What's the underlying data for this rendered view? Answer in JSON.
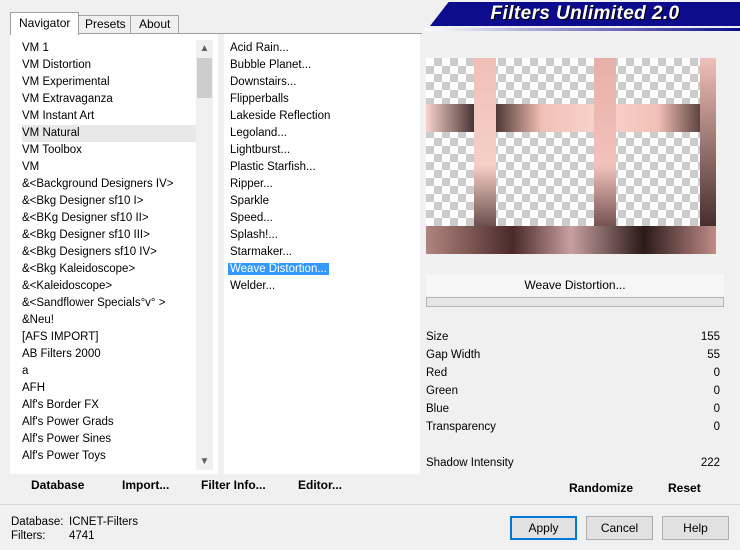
{
  "tabs": [
    "Navigator",
    "Presets",
    "About"
  ],
  "banner_title": "Filters Unlimited 2.0",
  "categories": [
    "VM 1",
    "VM Distortion",
    "VM Experimental",
    "VM Extravaganza",
    "VM Instant Art",
    "VM Natural",
    "VM Toolbox",
    "VM",
    "&<Background Designers IV>",
    "&<Bkg Designer sf10 I>",
    "&<BKg Designer sf10 II>",
    "&<Bkg Designer sf10 III>",
    "&<Bkg Designers sf10 IV>",
    "&<Bkg Kaleidoscope>",
    "&<Kaleidoscope>",
    "&<Sandflower Specials°v° >",
    "&Neu!",
    "[AFS IMPORT]",
    "AB Filters 2000",
    "a",
    "AFH",
    "Alf's Border FX",
    "Alf's Power Grads",
    "Alf's Power Sines",
    "Alf's Power Toys"
  ],
  "selected_category": "VM Natural",
  "filters": [
    "Acid Rain...",
    "Bubble Planet...",
    "Downstairs...",
    "Flipperballs",
    "Lakeside Reflection",
    "Legoland...",
    "Lightburst...",
    "Plastic Starfish...",
    "Ripper...",
    "Sparkle",
    "Speed...",
    "Splash!...",
    "Starmaker...",
    "Weave Distortion...",
    "Welder..."
  ],
  "selected_filter": "Weave Distortion...",
  "left_buttons": [
    "Database",
    "Import...",
    "Filter Info...",
    "Editor..."
  ],
  "preview_filter_name": "Weave Distortion...",
  "params": [
    {
      "label": "Size",
      "value": "155"
    },
    {
      "label": "Gap Width",
      "value": "55"
    },
    {
      "label": "Red",
      "value": "0"
    },
    {
      "label": "Green",
      "value": "0"
    },
    {
      "label": "Blue",
      "value": "0"
    },
    {
      "label": "Transparency",
      "value": "0"
    }
  ],
  "shadow_param": {
    "label": "Shadow Intensity",
    "value": "222"
  },
  "right_buttons": [
    "Randomize",
    "Reset"
  ],
  "status": {
    "database_label": "Database:",
    "database_value": "ICNET-Filters",
    "filters_label": "Filters:",
    "filters_value": "4741"
  },
  "dialog_buttons": [
    "Apply",
    "Cancel",
    "Help"
  ],
  "colors": {
    "banner": "#0c0c8c",
    "selection": "#3399ff"
  }
}
